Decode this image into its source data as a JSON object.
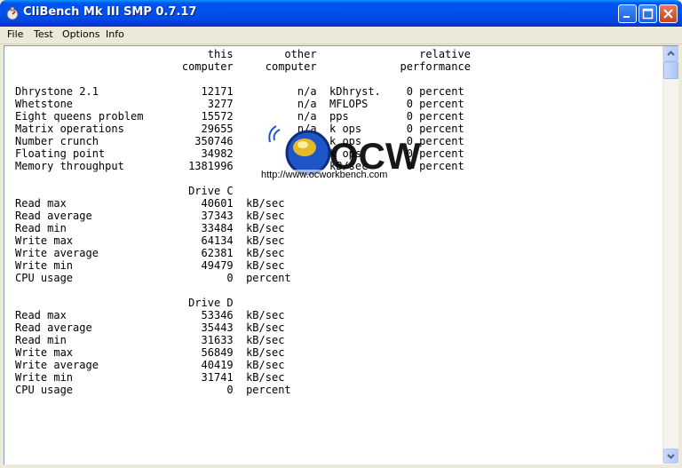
{
  "window": {
    "title": "CliBench Mk III SMP 0.7.17",
    "app_icon": "clibench-app-icon",
    "controls": [
      "minimize-icon",
      "maximize-icon",
      "close-icon"
    ]
  },
  "menu": {
    "items": [
      "File",
      "Test",
      "Options",
      "Info"
    ]
  },
  "report": {
    "text": "                              this        other                relative\n                          computer     computer             performance\n\nDhrystone 2.1                12171          n/a  kDhryst.    0 percent\nWhetstone                     3277          n/a  MFLOPS      0 percent\nEight queens problem         15572          n/a  pps         0 percent\nMatrix operations            29655          n/a  k ops       0 percent\nNumber crunch               350746          n/a  k ops       0 percent\nFloating point               34982          n/a  k ops       0 percent\nMemory throughput          1381996          n/a  kB/sec      0 percent\n\n                           Drive C\nRead max                     40601  kB/sec\nRead average                 37343  kB/sec\nRead min                     33484  kB/sec\nWrite max                    64134  kB/sec\nWrite average                62381  kB/sec\nWrite min                    49479  kB/sec\nCPU usage                        0  percent\n\n                           Drive D\nRead max                     53346  kB/sec\nRead average                 35443  kB/sec\nRead min                     31633  kB/sec\nWrite max                    56849  kB/sec\nWrite average                40419  kB/sec\nWrite min                    31741  kB/sec\nCPU usage                        0  percent"
  },
  "watermark": {
    "logo_text": "OCW",
    "url": "http://www.ocworkbench.com"
  },
  "colors": {
    "titlebar": "#0050ee",
    "window_bg": "#ece9d8",
    "content_bg": "#ffffff",
    "logo_blue": "#1e56c8",
    "logo_yellow": "#f0c020"
  }
}
